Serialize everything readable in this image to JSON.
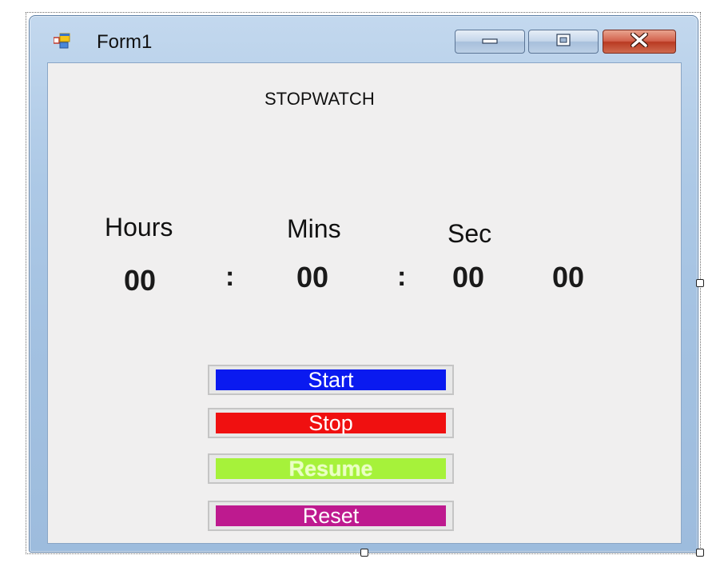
{
  "window": {
    "title": "Form1",
    "caption_buttons": [
      "minimize-icon",
      "maximize-icon",
      "close-icon"
    ]
  },
  "form": {
    "heading": "STOPWATCH",
    "unit_labels": {
      "hours": "Hours",
      "mins": "Mins",
      "sec": "Sec"
    },
    "display": {
      "hours": "00",
      "separator_1": ":",
      "mins": "00",
      "separator_2": ":",
      "sec": "00",
      "centisec": "00"
    },
    "buttons": {
      "start": {
        "label": "Start",
        "color": "#0a1af0"
      },
      "stop": {
        "label": "Stop",
        "color": "#f01010"
      },
      "resume": {
        "label": "Resume",
        "color": "#a6f23a"
      },
      "reset": {
        "label": "Reset",
        "color": "#be1a8f"
      }
    }
  },
  "colors": {
    "window_frame": "#adc9e6",
    "client_background": "#f0efef"
  }
}
